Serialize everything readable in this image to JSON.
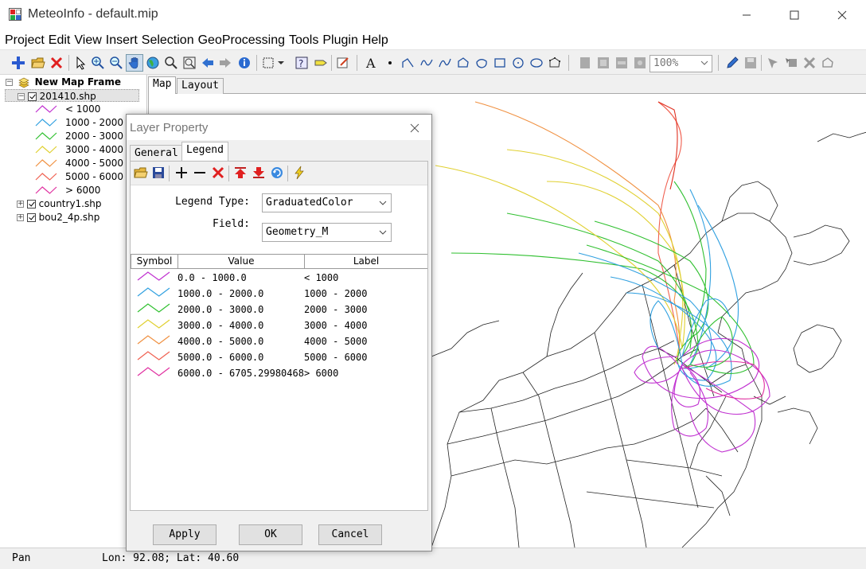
{
  "window": {
    "title": "MeteoInfo - default.mip"
  },
  "menu": [
    "Project",
    "Edit",
    "View",
    "Insert",
    "Selection",
    "GeoProcessing",
    "Tools",
    "Plugin",
    "Help"
  ],
  "toolbar": {
    "zoom_value": "100%"
  },
  "tree": {
    "root": "New Map Frame",
    "layers": [
      {
        "name": "201410.shp",
        "expanded": true
      },
      {
        "name": "country1.shp",
        "expanded": false
      },
      {
        "name": "bou2_4p.shp",
        "expanded": false
      }
    ],
    "legend_items": [
      {
        "label": "< 1000",
        "color": "#c030d0"
      },
      {
        "label": "1000 - 2000",
        "color": "#30a0e0"
      },
      {
        "label": "2000 - 3000",
        "color": "#30c030"
      },
      {
        "label": "3000 - 4000",
        "color": "#e0d030"
      },
      {
        "label": "4000 - 5000",
        "color": "#f09040"
      },
      {
        "label": "5000 - 6000",
        "color": "#f06050"
      },
      {
        "label": "> 6000",
        "color": "#e030a0"
      }
    ]
  },
  "main_tabs": [
    "Map",
    "Layout"
  ],
  "status": {
    "mode": "Pan",
    "coords": "Lon: 92.08; Lat: 40.60"
  },
  "dialog": {
    "title": "Layer Property",
    "tabs": [
      "General",
      "Legend"
    ],
    "legend_type_label": "Legend Type:",
    "legend_type_value": "GraduatedColor",
    "field_label": "Field:",
    "field_value": "Geometry_M",
    "columns": [
      "Symbol",
      "Value",
      "Label"
    ],
    "rows": [
      {
        "value": "0.0 - 1000.0",
        "label": "< 1000",
        "color": "#c030d0"
      },
      {
        "value": "1000.0 - 2000.0",
        "label": "1000 - 2000",
        "color": "#30a0e0"
      },
      {
        "value": "2000.0 - 3000.0",
        "label": "2000 - 3000",
        "color": "#30c030"
      },
      {
        "value": "3000.0 - 4000.0",
        "label": "3000 - 4000",
        "color": "#e0d030"
      },
      {
        "value": "4000.0 - 5000.0",
        "label": "4000 - 5000",
        "color": "#f09040"
      },
      {
        "value": "5000.0 - 6000.0",
        "label": "5000 - 6000",
        "color": "#f06050"
      },
      {
        "value": "6000.0 - 6705.29980468",
        "label": "> 6000",
        "color": "#e030a0"
      }
    ],
    "buttons": {
      "apply": "Apply",
      "ok": "OK",
      "cancel": "Cancel"
    }
  }
}
